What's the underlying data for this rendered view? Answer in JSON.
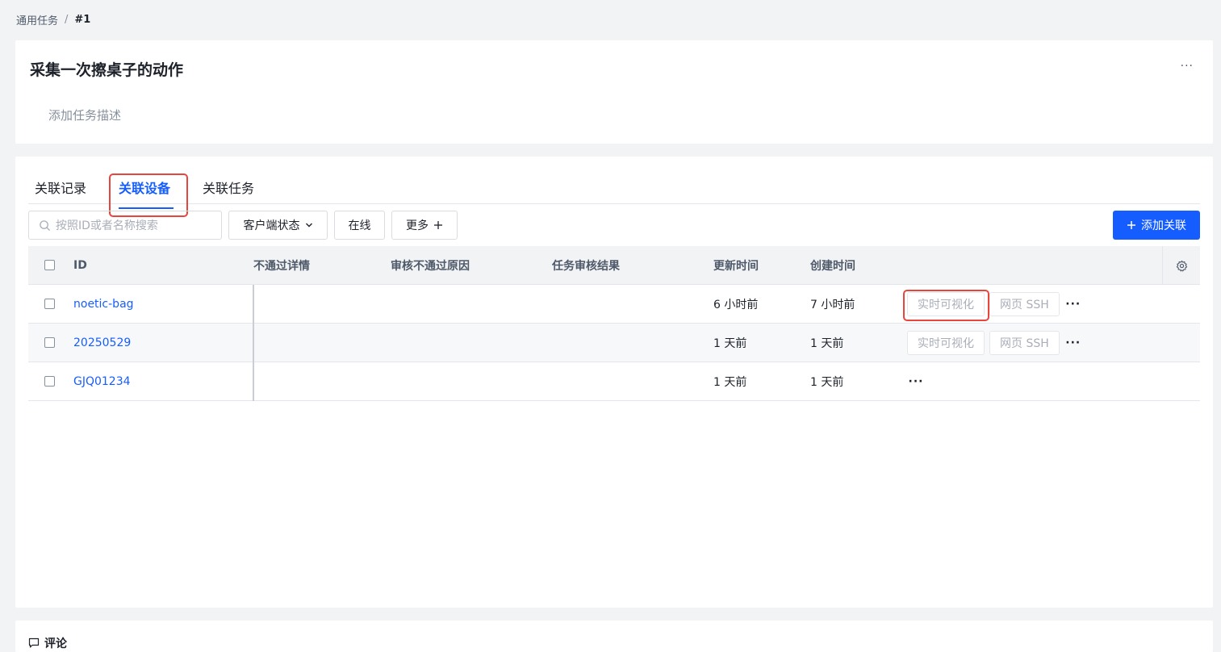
{
  "breadcrumb": {
    "parent": "通用任务",
    "separator": "/",
    "current": "#1"
  },
  "task": {
    "title": "采集一次擦桌子的动作",
    "description_placeholder": "添加任务描述",
    "more_label": "···"
  },
  "tabs": [
    {
      "label": "关联记录",
      "active": false
    },
    {
      "label": "关联设备",
      "active": true
    },
    {
      "label": "关联任务",
      "active": false
    }
  ],
  "toolbar": {
    "search_placeholder": "按照ID或者名称搜索",
    "client_status_label": "客户端状态",
    "online_label": "在线",
    "more_label": "更多",
    "add_label": "添加关联",
    "primary_color": "#165dff"
  },
  "table": {
    "columns": {
      "id": "ID",
      "no_pass_detail": "不通过详情",
      "reject_reason": "审核不通过原因",
      "review_result": "任务审核结果",
      "updated": "更新时间",
      "created": "创建时间"
    },
    "rows": [
      {
        "id": "noetic-bag",
        "updated": "6 小时前",
        "created": "7 小时前",
        "viz": "实时可视化",
        "ssh": "网页 SSH",
        "more": "···"
      },
      {
        "id": "20250529",
        "updated": "1 天前",
        "created": "1 天前",
        "viz": "实时可视化",
        "ssh": "网页 SSH",
        "more": "···"
      },
      {
        "id": "GJQ01234",
        "updated": "1 天前",
        "created": "1 天前",
        "more": "···"
      }
    ]
  },
  "comment": {
    "label": "评论"
  },
  "highlight_color": "#e8453c"
}
